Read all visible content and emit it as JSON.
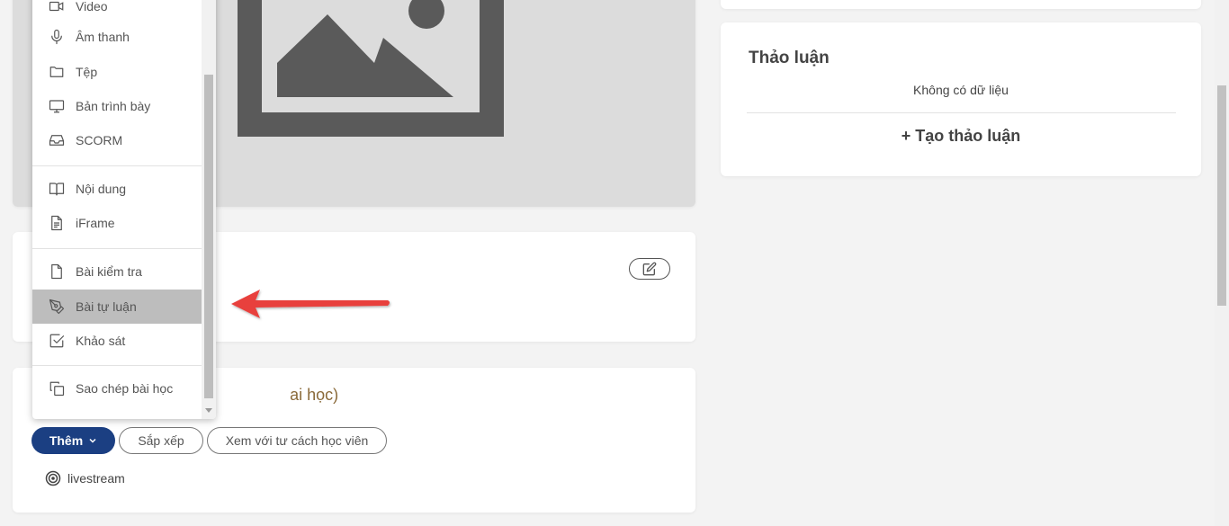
{
  "menu": {
    "items": [
      {
        "label": "Video",
        "icon": "video-icon"
      },
      {
        "label": "Âm thanh",
        "icon": "microphone-icon"
      },
      {
        "label": "Tệp",
        "icon": "folder-icon"
      },
      {
        "label": "Bản trình bày",
        "icon": "monitor-icon"
      },
      {
        "label": "SCORM",
        "icon": "inbox-icon"
      },
      {
        "label": "Nội dung",
        "icon": "book-icon"
      },
      {
        "label": "iFrame",
        "icon": "document-icon"
      },
      {
        "label": "Bài kiểm tra",
        "icon": "file-icon"
      },
      {
        "label": "Bài tự luận",
        "icon": "pen-tool-icon"
      },
      {
        "label": "Khảo sát",
        "icon": "checkbox-icon"
      },
      {
        "label": "Sao chép bài học",
        "icon": "copy-icon"
      }
    ],
    "active_item": "Bài tự luận"
  },
  "lessons": {
    "title_visible": "ai học)",
    "add_label": "Thêm",
    "sort_label": "Sắp xếp",
    "preview_label": "Xem với tư cách học viên",
    "livestream_label": "livestream"
  },
  "discussion": {
    "title": "Thảo luận",
    "empty_message": "Không có dữ liệu",
    "create_label": "+ Tạo thảo luận"
  },
  "colors": {
    "primary": "#1b3f82",
    "arrow": "#e8413c",
    "menu_active": "#bdbdbd",
    "placeholder": "#5a5a5a"
  }
}
